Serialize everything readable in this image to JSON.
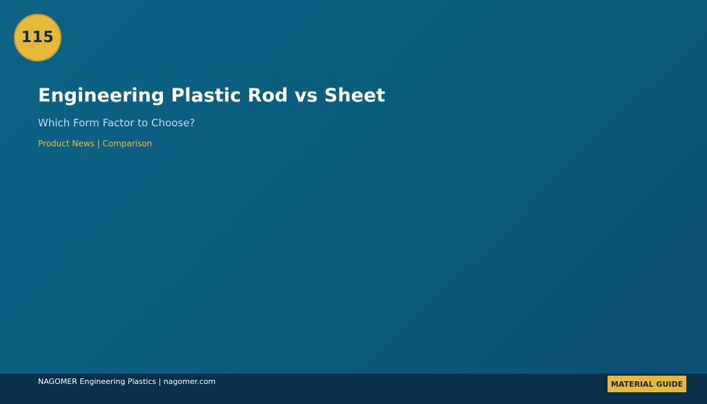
{
  "badge": {
    "number": "115"
  },
  "hero": {
    "title": "Engineering Plastic Rod vs Sheet",
    "subtitle": "Which Form Factor to Choose?",
    "meta": "Product News | Comparison"
  },
  "footer": {
    "brand_text": "NAGOMER Engineering Plastics | nagomer.com",
    "guide_label": "MATERIAL GUIDE"
  },
  "colors": {
    "background": "#0b5d7f",
    "accent": "#e6b93a",
    "footer_bg": "#0a2f49",
    "title_text": "#ffffff",
    "subtitle_text": "#c4d8e8"
  }
}
